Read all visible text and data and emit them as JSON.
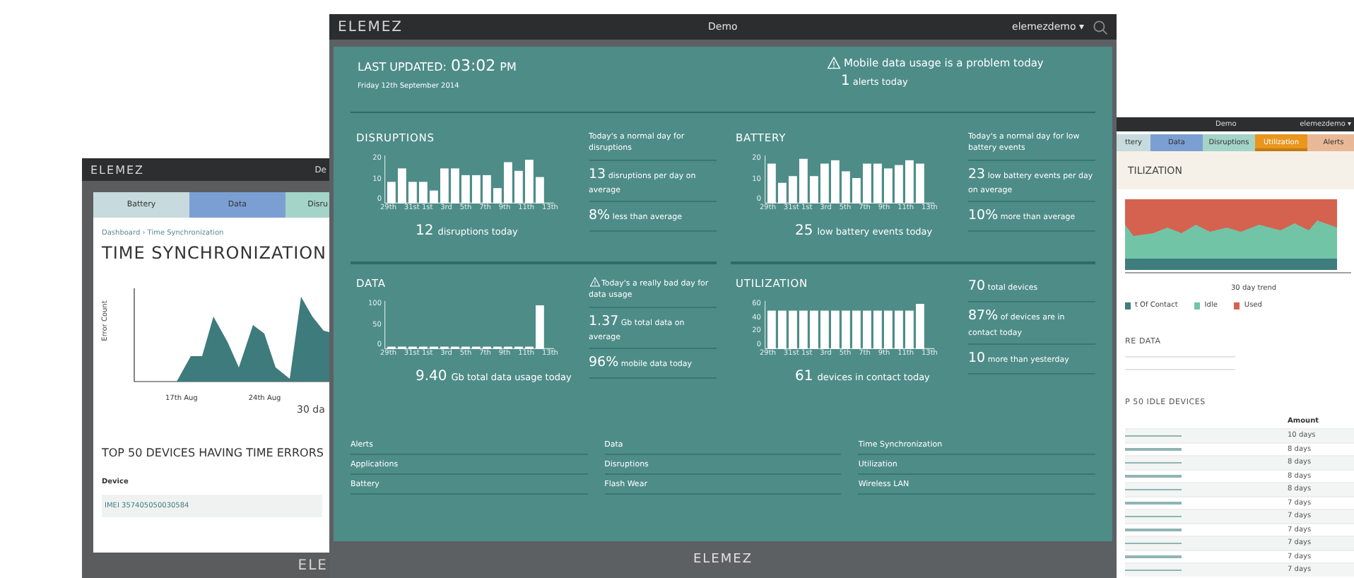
{
  "left_window": {
    "brand": "ELEMEZ",
    "title": "De",
    "tabs": [
      {
        "label": "Battery",
        "color": "#c7dadd",
        "selected": false
      },
      {
        "label": "Data",
        "color": "#7c9fd3",
        "selected": false
      },
      {
        "label": "Disru",
        "color": "#a4d3c7",
        "selected": false
      }
    ],
    "breadcrumb": "Dashboard › Time Synchronization",
    "heading": "TIME SYNCHRONIZATION",
    "y_axis_label": "Error Count",
    "x_labels": [
      "17th Aug",
      "24th Aug"
    ],
    "chart_caption": "30 da",
    "table_title": "TOP 50 DEVICES HAVING TIME ERRORS",
    "column": "Device",
    "rows": [
      "IMEI 357405050030584"
    ],
    "footer_brand": "ELE"
  },
  "main_window": {
    "brand": "ELEMEZ",
    "title": "Demo",
    "user": "elemezdemo ▾",
    "summary": {
      "last_updated_label": "LAST UPDATED:",
      "time": "03:02",
      "period": "PM",
      "date": "Friday 12th September 2014",
      "alert": "Mobile data usage is a problem today",
      "alert_count": "1",
      "alert_count_label": "alerts today"
    },
    "panels": [
      {
        "title": "DISRUPTIONS",
        "total": "12",
        "total_label": "disruptions today",
        "y_ticks": [
          "20",
          "10",
          "0"
        ],
        "x_ticks": [
          "29th",
          "31st 1st",
          "3rd",
          "5th",
          "7th",
          "9th",
          "11th",
          "13th"
        ],
        "stats": [
          {
            "kind": "note",
            "warning": false,
            "text": "Today's a normal day for disruptions"
          },
          {
            "kind": "figure",
            "value": "13",
            "text": "disruptions per day on average"
          },
          {
            "kind": "figure",
            "value": "8%",
            "text": "less than average"
          }
        ]
      },
      {
        "title": "BATTERY",
        "total": "25",
        "total_label": "low battery events today",
        "y_ticks": [
          "20",
          "10",
          "0"
        ],
        "x_ticks": [
          "29th",
          "31st 1st",
          "3rd",
          "5th",
          "7th",
          "9th",
          "11th",
          "13th"
        ],
        "stats": [
          {
            "kind": "note",
            "warning": false,
            "text": "Today's a normal day for low battery events"
          },
          {
            "kind": "figure",
            "value": "23",
            "text": "low battery events per day on average"
          },
          {
            "kind": "figure",
            "value": "10%",
            "text": "more than average"
          }
        ]
      },
      {
        "title": "DATA",
        "total": "9.40",
        "total_label": "Gb total data usage today",
        "y_ticks": [
          "100",
          "50",
          "0"
        ],
        "x_ticks": [
          "29th",
          "31st 1st",
          "3rd",
          "5th",
          "7th",
          "9th",
          "11th",
          "13th"
        ],
        "stats": [
          {
            "kind": "note",
            "warning": true,
            "text": "Today's a really bad day for data usage"
          },
          {
            "kind": "figure",
            "value": "1.37",
            "text": "Gb total data on average"
          },
          {
            "kind": "figure",
            "value": "96%",
            "text": "mobile data today"
          }
        ]
      },
      {
        "title": "UTILIZATION",
        "total": "61",
        "total_label": "devices in contact today",
        "y_ticks": [
          "60",
          "40",
          "20",
          "0"
        ],
        "x_ticks": [
          "29th",
          "31st 1st",
          "3rd",
          "5th",
          "7th",
          "9th",
          "11th",
          "13th"
        ],
        "stats": [
          {
            "kind": "figure",
            "value": "70",
            "text": "total devices"
          },
          {
            "kind": "figure",
            "value": "87%",
            "text": "of devices are in contact today"
          },
          {
            "kind": "figure",
            "value": "10",
            "text": "more than yesterday"
          }
        ]
      }
    ],
    "links": [
      [
        "Alerts",
        "Applications",
        "Battery"
      ],
      [
        "Data",
        "Disruptions",
        "Flash Wear"
      ],
      [
        "Time Synchronization",
        "Utilization",
        "Wireless LAN"
      ]
    ],
    "footer_brand": "ELEMEZ"
  },
  "right_window": {
    "title": "Demo",
    "user": "elemezdemo ▾",
    "tabs": [
      {
        "label": "ttery",
        "color": "#c7dadd",
        "selected": false
      },
      {
        "label": "Data",
        "color": "#7c9fd3",
        "selected": false
      },
      {
        "label": "Disruptions",
        "color": "#a4d3c7",
        "selected": false
      },
      {
        "label": "Utilization",
        "color": "#e8961e",
        "selected": true
      },
      {
        "label": "Alerts",
        "color": "#e9b896",
        "selected": false
      }
    ],
    "heading": "TILIZATION",
    "chart_caption": "30 day trend",
    "legend": [
      {
        "label": "t Of Contact",
        "color": "#3f7d7e"
      },
      {
        "label": "Idle",
        "color": "#72c4a6"
      },
      {
        "label": "Used",
        "color": "#d5624f"
      }
    ],
    "section_title": "RE DATA",
    "table_title": "P 50 IDLE DEVICES",
    "column": "Amount",
    "rows": [
      "10 days",
      "8 days",
      "8 days",
      "8 days",
      "8 days",
      "7 days",
      "7 days",
      "7 days",
      "7 days",
      "7 days",
      "7 days"
    ]
  }
}
